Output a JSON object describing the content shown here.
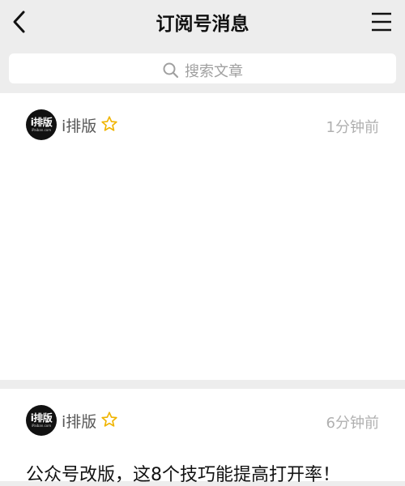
{
  "header": {
    "title": "订阅号消息"
  },
  "search": {
    "placeholder": "搜索文章"
  },
  "messages": [
    {
      "account": "i排版",
      "avatar_text": "i排版",
      "avatar_subtext": "iPaiban.com",
      "time": "1分钟前"
    },
    {
      "account": "i排版",
      "avatar_text": "i排版",
      "avatar_subtext": "iPaiban.com",
      "time": "6分钟前",
      "article_title": "公众号改版，这8个技巧能提高打开率！"
    }
  ],
  "colors": {
    "background": "#ededed",
    "card": "#ffffff",
    "star": "#f0b400",
    "secondary_text": "#b0b0b0"
  },
  "icons": {
    "back": "chevron-left-icon",
    "menu": "hamburger-menu-icon",
    "search": "search-icon",
    "star": "star-outline-icon"
  }
}
